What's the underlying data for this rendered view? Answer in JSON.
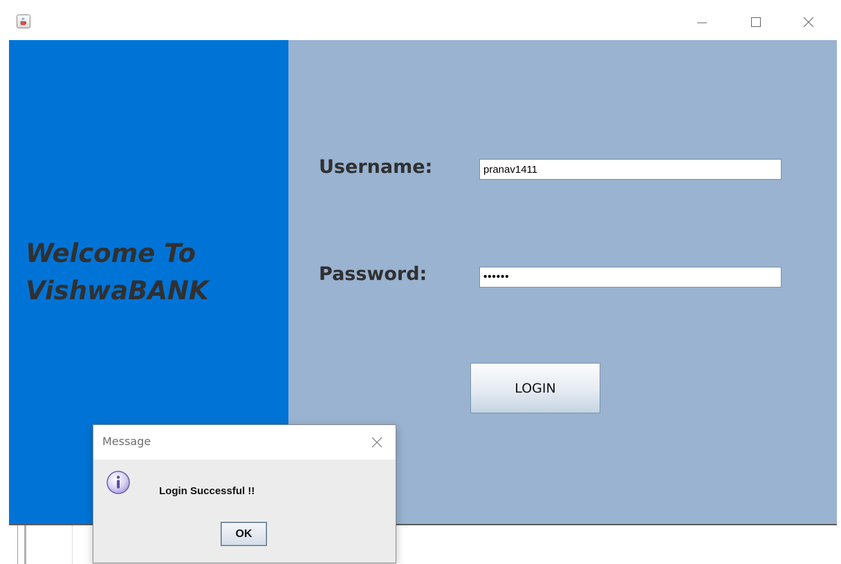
{
  "window": {
    "icons": {
      "app": "java-cup-icon",
      "minimize": "minimize-icon",
      "maximize": "maximize-icon",
      "close": "close-icon"
    }
  },
  "welcome": {
    "line1": "Welcome To",
    "line2": "VishwaBANK"
  },
  "form": {
    "username_label": "Username:",
    "username_value": "pranav1411",
    "password_label": "Password:",
    "password_display": "••••••",
    "login_label": "LOGIN"
  },
  "dialog": {
    "title": "Message",
    "message": "Login Successful !!",
    "ok_label": "OK",
    "icons": {
      "info": "info-icon",
      "close": "close-icon"
    }
  },
  "colors": {
    "left_panel": "#0074d6",
    "right_panel": "#99b3d1",
    "text": "#303030"
  }
}
